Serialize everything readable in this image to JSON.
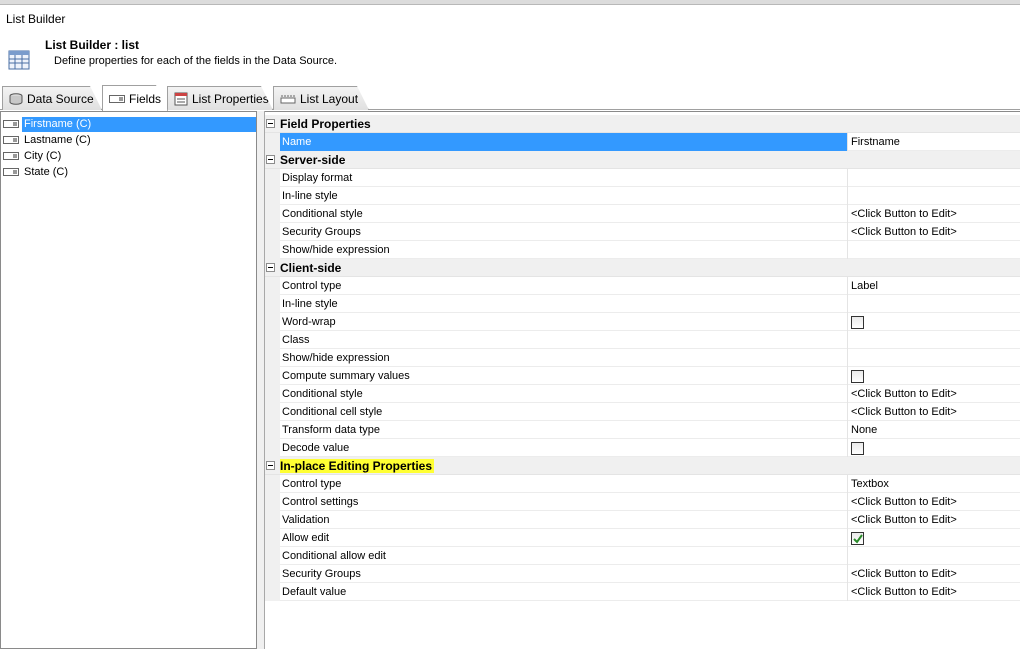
{
  "window": {
    "title": "List Builder"
  },
  "header": {
    "title": "List Builder : list",
    "description": "Define properties for each of the fields in the Data Source."
  },
  "tabs": [
    {
      "label": "Data Source",
      "icon": "database-icon"
    },
    {
      "label": "Fields",
      "icon": "field-icon",
      "active": true
    },
    {
      "label": "List Properties",
      "icon": "properties-icon"
    },
    {
      "label": "List Layout",
      "icon": "layout-icon"
    }
  ],
  "fields": [
    {
      "label": "Firstname (C)",
      "selected": true
    },
    {
      "label": "Lastname (C)"
    },
    {
      "label": "City (C)"
    },
    {
      "label": "State (C)"
    }
  ],
  "property_grid": {
    "field_properties": {
      "title": "Field Properties",
      "rows": [
        {
          "name": "Name",
          "value": "Firstname"
        }
      ]
    },
    "server_side": {
      "title": "Server-side",
      "rows": [
        {
          "name": "Display format",
          "value": ""
        },
        {
          "name": "In-line style",
          "value": ""
        },
        {
          "name": "Conditional style",
          "value": "<Click Button to Edit>"
        },
        {
          "name": "Security Groups",
          "value": "<Click Button to Edit>"
        },
        {
          "name": "Show/hide expression",
          "value": ""
        }
      ]
    },
    "client_side": {
      "title": "Client-side",
      "rows": [
        {
          "name": "Control type",
          "value": "Label"
        },
        {
          "name": "In-line style",
          "value": ""
        },
        {
          "name": "Word-wrap",
          "checkbox": false
        },
        {
          "name": "Class",
          "value": ""
        },
        {
          "name": "Show/hide expression",
          "value": ""
        },
        {
          "name": "Compute summary values",
          "checkbox": false
        },
        {
          "name": "Conditional style",
          "value": "<Click Button to Edit>"
        },
        {
          "name": "Conditional cell style",
          "value": "<Click Button to Edit>"
        },
        {
          "name": "Transform data type",
          "value": "None"
        },
        {
          "name": "Decode value",
          "checkbox": false
        }
      ]
    },
    "inplace_editing": {
      "title": "In-place Editing Properties",
      "rows": [
        {
          "name": "Control type",
          "value": "Textbox"
        },
        {
          "name": "Control settings",
          "value": "<Click Button to Edit>"
        },
        {
          "name": "Validation",
          "value": "<Click Button to Edit>"
        },
        {
          "name": "Allow edit",
          "checkbox": true
        },
        {
          "name": "Conditional allow edit",
          "value": ""
        },
        {
          "name": "Security Groups",
          "value": "<Click Button to Edit>"
        },
        {
          "name": "Default value",
          "value": "<Click Button to Edit>"
        }
      ]
    }
  },
  "colors": {
    "selection": "#3399ff",
    "highlight": "#ffff33",
    "check": "#2a8a2a"
  }
}
